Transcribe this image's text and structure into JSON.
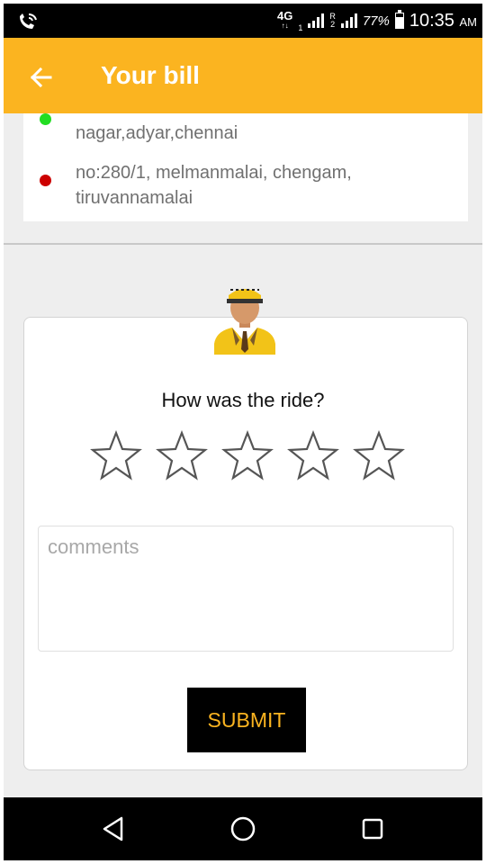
{
  "status_bar": {
    "network_label": "4G",
    "sim1_label": "1",
    "roaming_label": "R",
    "sim2_label": "2",
    "battery_percent": "77%",
    "battery_level": 0.77,
    "time": "10:35",
    "ampm": "AM"
  },
  "header": {
    "title": "Your bill",
    "accent_color": "#fbb420",
    "back_icon": "arrow-left-icon"
  },
  "addresses": [
    {
      "text": "nagar,adyar,chennai",
      "dot_color": "#22dd22"
    },
    {
      "text": "no:280/1, melmanmalai, chengam, tiruvannamalai",
      "dot_color": "#cc0000"
    }
  ],
  "rating": {
    "question": "How was the ride?",
    "stars_total": 5,
    "stars_selected": 0,
    "comments_placeholder": "comments",
    "comments_value": "",
    "submit_label": "SUBMIT"
  },
  "nav_bar": {
    "icons": [
      "back-triangle-icon",
      "home-circle-icon",
      "recents-square-icon"
    ]
  }
}
